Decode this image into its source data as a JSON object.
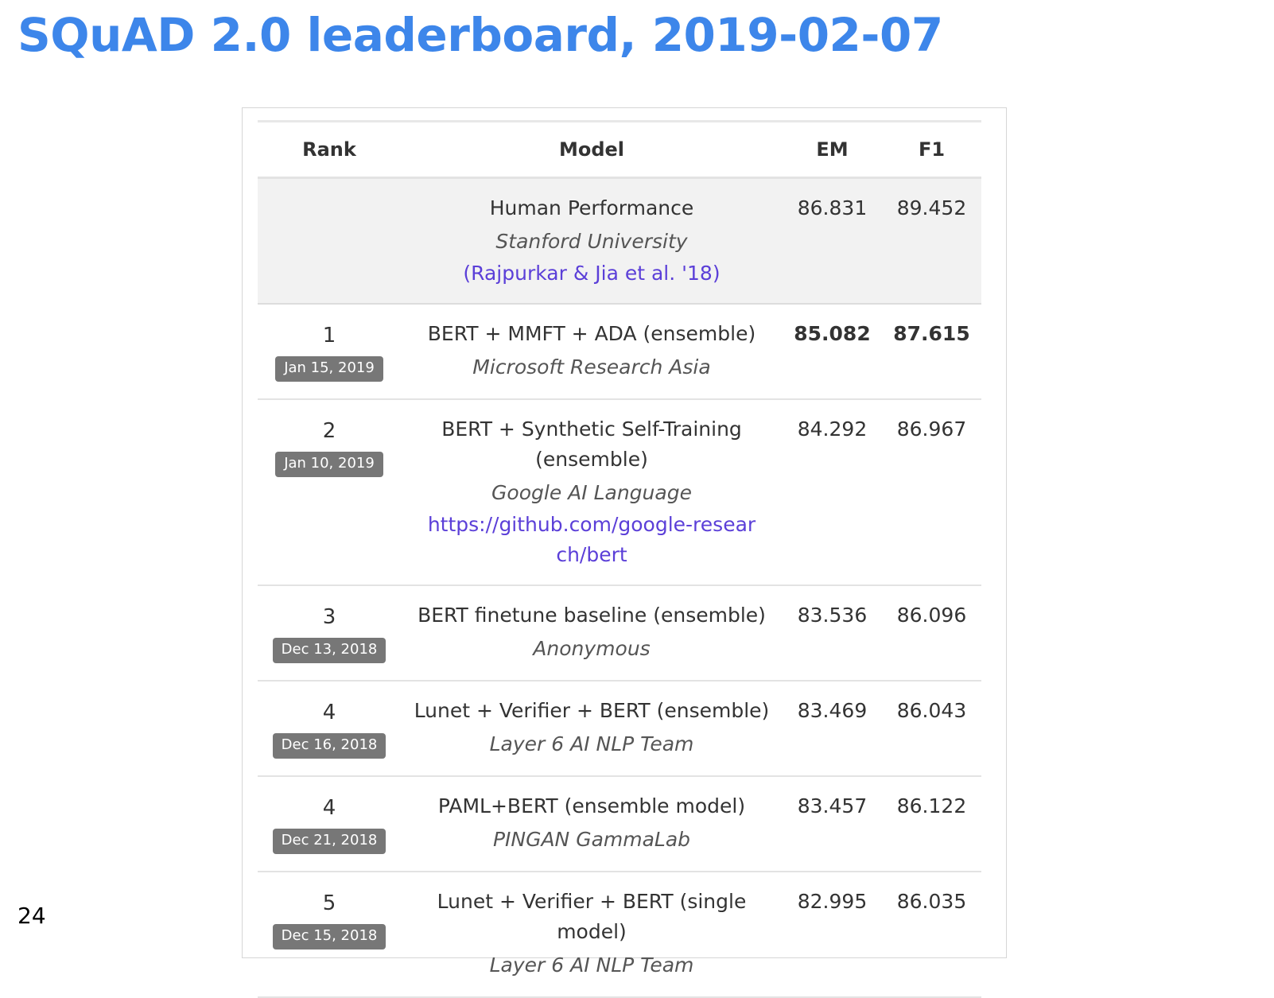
{
  "slide": {
    "title": "SQuAD 2.0 leaderboard, 2019-02-07",
    "page_number": "24"
  },
  "leaderboard": {
    "headers": {
      "rank": "Rank",
      "model": "Model",
      "em": "EM",
      "f1": "F1"
    },
    "human": {
      "model": "Human Performance",
      "org": "Stanford University",
      "link": "(Rajpurkar & Jia et al. '18)",
      "em": "86.831",
      "f1": "89.452"
    },
    "rows": [
      {
        "rank": "1",
        "date": "Jan 15, 2019",
        "model": "BERT + MMFT + ADA (ensemble)",
        "org": "Microsoft Research Asia",
        "link": "",
        "em": "85.082",
        "f1": "87.615"
      },
      {
        "rank": "2",
        "date": "Jan 10, 2019",
        "model": "BERT + Synthetic Self-Training (ensemble)",
        "org": "Google AI Language",
        "link": "https://github.com/google-research/bert",
        "em": "84.292",
        "f1": "86.967"
      },
      {
        "rank": "3",
        "date": "Dec 13, 2018",
        "model": "BERT finetune baseline (ensemble)",
        "org": "Anonymous",
        "link": "",
        "em": "83.536",
        "f1": "86.096"
      },
      {
        "rank": "4",
        "date": "Dec 16, 2018",
        "model": "Lunet + Verifier + BERT (ensemble)",
        "org": "Layer 6 AI NLP Team",
        "link": "",
        "em": "83.469",
        "f1": "86.043"
      },
      {
        "rank": "4",
        "date": "Dec 21, 2018",
        "model": "PAML+BERT (ensemble model)",
        "org": "PINGAN GammaLab",
        "link": "",
        "em": "83.457",
        "f1": "86.122"
      },
      {
        "rank": "5",
        "date": "Dec 15, 2018",
        "model": "Lunet + Verifier + BERT (single model)",
        "org": "Layer 6 AI NLP Team",
        "link": "",
        "em": "82.995",
        "f1": "86.035"
      }
    ]
  }
}
